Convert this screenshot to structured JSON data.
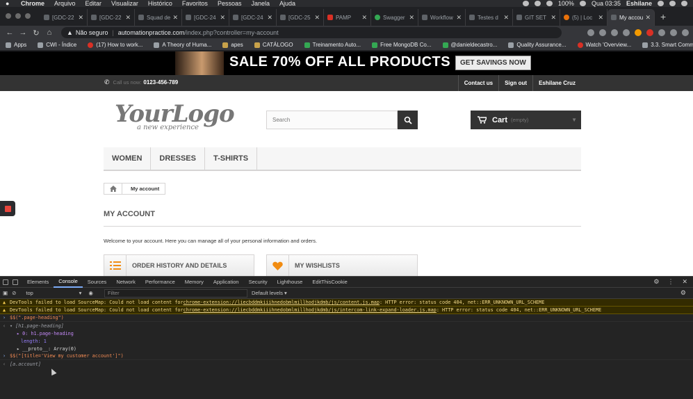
{
  "macos": {
    "app": "Chrome",
    "menus": [
      "Arquivo",
      "Editar",
      "Visualizar",
      "Histórico",
      "Favoritos",
      "Pessoas",
      "Janela",
      "Ajuda"
    ],
    "battery": "100%",
    "clock": "Qua 03:35",
    "user": "Eshilane"
  },
  "tabs": [
    {
      "label": "[GDC-22",
      "icon": "jira-icon"
    },
    {
      "label": "[GDC-22",
      "icon": "jira-icon"
    },
    {
      "label": "Squad de",
      "icon": "jira-icon"
    },
    {
      "label": "[GDC-24",
      "icon": "jira-icon"
    },
    {
      "label": "[GDC-24",
      "icon": "jira-icon"
    },
    {
      "label": "[GDC-25",
      "icon": "jira-icon"
    },
    {
      "label": "PAMP",
      "icon": "angular-icon"
    },
    {
      "label": "Swagger",
      "icon": "swagger-icon"
    },
    {
      "label": "Workflow",
      "icon": "jira-icon"
    },
    {
      "label": "Testes d",
      "icon": "jira-icon"
    },
    {
      "label": "GIT SET",
      "icon": "doc-icon"
    },
    {
      "label": "(5) | Loc",
      "icon": "target-icon"
    },
    {
      "label": "My accou",
      "icon": "page-icon"
    }
  ],
  "address": {
    "security": "Não seguro",
    "host": "automationpractice.com",
    "path": "/index.php?controller=my-account"
  },
  "bookmarks": [
    {
      "label": "Apps",
      "icon": "apps-icon"
    },
    {
      "label": "CWI - Índice",
      "icon": "cwi-icon"
    },
    {
      "label": "(17) How to work...",
      "icon": "youtube-icon"
    },
    {
      "label": "A Theory of Huma...",
      "icon": "book-icon"
    },
    {
      "label": "apes",
      "icon": "folder-icon"
    },
    {
      "label": "CATÁLOGO",
      "icon": "folder-icon"
    },
    {
      "label": "Treinamento Auto...",
      "icon": "plus-icon"
    },
    {
      "label": "Free MongoDB Co...",
      "icon": "leaf-icon"
    },
    {
      "label": "@danieldecastro...",
      "icon": "github-icon"
    },
    {
      "label": "Quality Assurance...",
      "icon": "page-icon"
    },
    {
      "label": "Watch 'Overview...",
      "icon": "play-icon"
    },
    {
      "label": "3.3. Smart Commi...",
      "icon": "page-icon"
    }
  ],
  "site": {
    "promo": {
      "headline": "SALE 70% OFF ALL PRODUCTS",
      "cta": "GET SAVINGS NOW"
    },
    "call_us": "Call us now:",
    "phone": "0123-456-789",
    "nav_links": [
      "Contact us",
      "Sign out",
      "Eshilane Cruz"
    ],
    "logo_main": "YourLogo",
    "logo_sub": "a new experience",
    "search_placeholder": "Search",
    "cart_label": "Cart",
    "cart_status": "(empty)",
    "menu": [
      "WOMEN",
      "DRESSES",
      "T-SHIRTS"
    ],
    "breadcrumb": "My account",
    "heading": "MY ACCOUNT",
    "welcome": "Welcome to your account. Here you can manage all of your personal information and orders.",
    "buttons": [
      "ORDER HISTORY AND DETAILS",
      "MY WISHLISTS"
    ]
  },
  "devtools": {
    "tabs": [
      "Elements",
      "Console",
      "Sources",
      "Network",
      "Performance",
      "Memory",
      "Application",
      "Security",
      "Lighthouse",
      "EditThisCookie"
    ],
    "active_tab": "Console",
    "context": "top",
    "filter_placeholder": "Filter",
    "levels": "Default levels ▾",
    "warn1_prefix": "DevTools failed to load SourceMap: Could not load content for ",
    "warn1_link": "chrome-extension://liecbddmkiiihnedobmlmillhodjkdmb/js/content.js.map",
    "warn1_suffix": ": HTTP error: status code 404, net::ERR_UNKNOWN_URL_SCHEME",
    "warn2_prefix": "DevTools failed to load SourceMap: Could not load content for ",
    "warn2_link": "chrome-extension://liecbddmkiiihnedobmlmillhodjkdmb/js/intercom-link-expand-loader.js.map",
    "warn2_suffix": ": HTTP error: status code 404, net::ERR_UNKNOWN_URL_SCHEME",
    "cmd1": "$$(\".page-heading\")",
    "res1": "▾ [h1.page-heading]",
    "res1_item": "▸ 0: h1.page-heading",
    "res1_length": "length: 1",
    "res1_proto": "▸ __proto__: Array(0)",
    "cmd2": "$$(\"[title='View my customer account']\")",
    "res2": "[a.account]"
  }
}
